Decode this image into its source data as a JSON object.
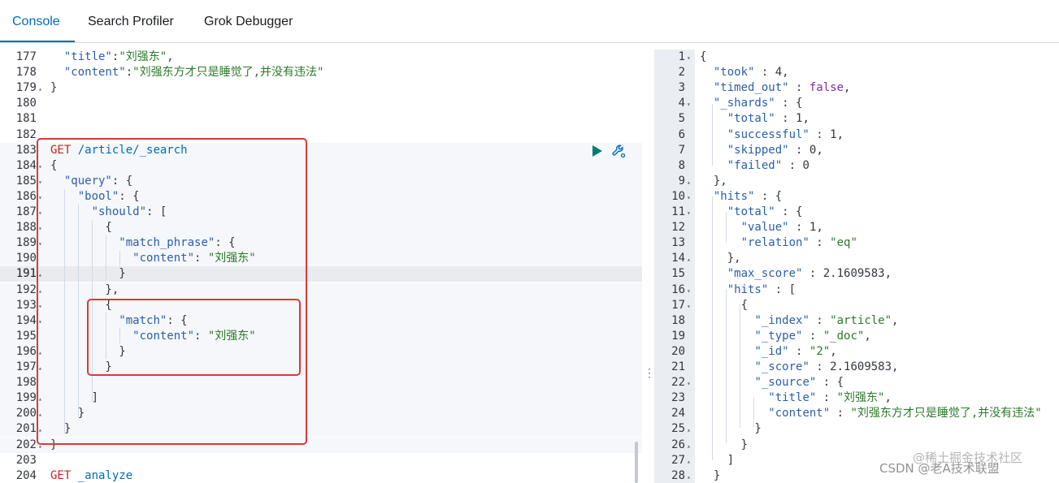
{
  "tabs": [
    {
      "label": "Console",
      "active": true
    },
    {
      "label": "Search Profiler",
      "active": false
    },
    {
      "label": "Grok Debugger",
      "active": false
    }
  ],
  "request_editor": {
    "lines": [
      {
        "num": "177",
        "fold": "",
        "text": "  \"title\":\"刘强东\","
      },
      {
        "num": "178",
        "fold": "",
        "text": "  \"content\":\"刘强东方才只是睡觉了,并没有违法\""
      },
      {
        "num": "179",
        "fold": "▴",
        "text": "}"
      },
      {
        "num": "180",
        "fold": "",
        "text": ""
      },
      {
        "num": "181",
        "fold": "",
        "text": ""
      },
      {
        "num": "182",
        "fold": "",
        "text": ""
      },
      {
        "num": "183",
        "fold": "",
        "text": "GET /article/_search"
      },
      {
        "num": "184",
        "fold": "▾",
        "text": "{"
      },
      {
        "num": "185",
        "fold": "▾",
        "text": "  \"query\": {"
      },
      {
        "num": "186",
        "fold": "▾",
        "text": "    \"bool\": {"
      },
      {
        "num": "187",
        "fold": "▾",
        "text": "      \"should\": ["
      },
      {
        "num": "188",
        "fold": "▾",
        "text": "        {"
      },
      {
        "num": "189",
        "fold": "▾",
        "text": "          \"match_phrase\": {"
      },
      {
        "num": "190",
        "fold": "",
        "text": "            \"content\": \"刘强东\""
      },
      {
        "num": "191",
        "fold": "▴",
        "text": "          }"
      },
      {
        "num": "192",
        "fold": "▴",
        "text": "        },"
      },
      {
        "num": "193",
        "fold": "▾",
        "text": "        {"
      },
      {
        "num": "194",
        "fold": "▾",
        "text": "          \"match\": {"
      },
      {
        "num": "195",
        "fold": "",
        "text": "            \"content\": \"刘强东\""
      },
      {
        "num": "196",
        "fold": "▴",
        "text": "          }"
      },
      {
        "num": "197",
        "fold": "▴",
        "text": "        }"
      },
      {
        "num": "198",
        "fold": "",
        "text": "        "
      },
      {
        "num": "199",
        "fold": "▴",
        "text": "      ]"
      },
      {
        "num": "200",
        "fold": "▴",
        "text": "    }"
      },
      {
        "num": "201",
        "fold": "▴",
        "text": "  }"
      },
      {
        "num": "202",
        "fold": "▴",
        "text": "}"
      },
      {
        "num": "203",
        "fold": "",
        "text": ""
      },
      {
        "num": "204",
        "fold": "",
        "text": "GET _analyze"
      }
    ]
  },
  "response_viewer": {
    "lines": [
      {
        "num": "1",
        "fold": "▾",
        "text": "{"
      },
      {
        "num": "2",
        "fold": "",
        "text": "  \"took\" : 4,"
      },
      {
        "num": "3",
        "fold": "",
        "text": "  \"timed_out\" : false,"
      },
      {
        "num": "4",
        "fold": "▾",
        "text": "  \"_shards\" : {"
      },
      {
        "num": "5",
        "fold": "",
        "text": "    \"total\" : 1,"
      },
      {
        "num": "6",
        "fold": "",
        "text": "    \"successful\" : 1,"
      },
      {
        "num": "7",
        "fold": "",
        "text": "    \"skipped\" : 0,"
      },
      {
        "num": "8",
        "fold": "",
        "text": "    \"failed\" : 0"
      },
      {
        "num": "9",
        "fold": "▴",
        "text": "  },"
      },
      {
        "num": "10",
        "fold": "▾",
        "text": "  \"hits\" : {"
      },
      {
        "num": "11",
        "fold": "▾",
        "text": "    \"total\" : {"
      },
      {
        "num": "12",
        "fold": "",
        "text": "      \"value\" : 1,"
      },
      {
        "num": "13",
        "fold": "",
        "text": "      \"relation\" : \"eq\""
      },
      {
        "num": "14",
        "fold": "▴",
        "text": "    },"
      },
      {
        "num": "15",
        "fold": "",
        "text": "    \"max_score\" : 2.1609583,"
      },
      {
        "num": "16",
        "fold": "▾",
        "text": "    \"hits\" : ["
      },
      {
        "num": "17",
        "fold": "▾",
        "text": "      {"
      },
      {
        "num": "18",
        "fold": "",
        "text": "        \"_index\" : \"article\","
      },
      {
        "num": "19",
        "fold": "",
        "text": "        \"_type\" : \"_doc\","
      },
      {
        "num": "20",
        "fold": "",
        "text": "        \"_id\" : \"2\","
      },
      {
        "num": "21",
        "fold": "",
        "text": "        \"_score\" : 2.1609583,"
      },
      {
        "num": "22",
        "fold": "▾",
        "text": "        \"_source\" : {"
      },
      {
        "num": "23",
        "fold": "",
        "text": "          \"title\" : \"刘强东\","
      },
      {
        "num": "24",
        "fold": "",
        "text": "          \"content\" : \"刘强东方才只是睡觉了,并没有违法\""
      },
      {
        "num": "25",
        "fold": "▴",
        "text": "        }"
      },
      {
        "num": "26",
        "fold": "▴",
        "text": "      }"
      },
      {
        "num": "27",
        "fold": "▴",
        "text": "    ]"
      },
      {
        "num": "28",
        "fold": "▴",
        "text": "  }"
      }
    ]
  },
  "icons": {
    "run": "play-icon",
    "settings": "wrench-icon",
    "resize": "drag-handle-icon"
  },
  "watermark": {
    "line1": "@稀土掘金技术社区",
    "line2": "CSDN @老A技术联盟"
  },
  "colors": {
    "accent": "#006bb8",
    "annotation": "#d93a3a",
    "method": "#bd271e",
    "string": "#2b7a2b",
    "property": "#2b5fa8"
  }
}
